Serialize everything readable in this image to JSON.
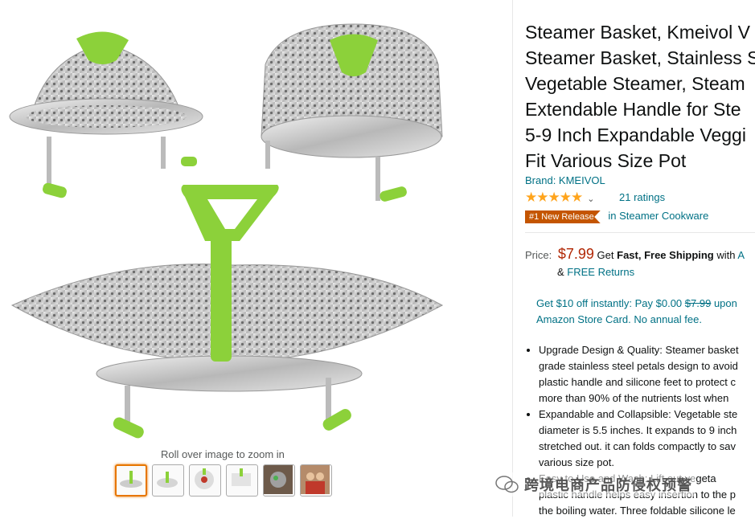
{
  "gallery": {
    "zoom_caption": "Roll over image to zoom in",
    "thumbnails": [
      "thumb-1",
      "thumb-2",
      "thumb-3",
      "thumb-4",
      "thumb-5",
      "thumb-6"
    ],
    "selected_index": 0
  },
  "product": {
    "title_lines": [
      "Steamer Basket, Kmeivol V",
      "Steamer Basket, Stainless S",
      "Vegetable Steamer, Steam",
      "Extendable Handle for Ste",
      "5-9 Inch Expandable Veggi",
      "Fit Various Size Pot"
    ],
    "brand": "Brand: KMEIVOL",
    "stars": "★★★★★",
    "rating_value": 5,
    "ratings_count": "21 ratings",
    "badge": "#1 New Release",
    "badge_category": "in Steamer Cookware"
  },
  "price": {
    "label": "Price:",
    "value": "$7.99",
    "get": "Get",
    "shipping_bold": "Fast, Free Shipping",
    "with": "with",
    "with_link": "A",
    "amp": "&",
    "returns": "FREE Returns"
  },
  "promo": {
    "line1_a": "Get $10 off instantly: Pay $0.00",
    "line1_strike": "$7.99",
    "line1_b": "upon",
    "line2": "Amazon Store Card. No annual fee."
  },
  "bullets": [
    [
      "Upgrade Design & Quality: Steamer basket",
      "grade stainless steel petals design to avoid",
      "plastic handle and silicone feet to protect c",
      "more than 90% of the nutrients lost when"
    ],
    [
      "Expandable and Collapsible: Vegetable ste",
      "diameter is 5.5 inches. It expands to 9 inch",
      "stretched out. it can folds compactly to sav",
      "various size pot."
    ],
    [
      "Easy to Use and Wash: Lift out vegeta",
      "plastic handle helps easy insertion to the p",
      "the boiling water. Three foldable silicone le"
    ]
  ],
  "watermark": {
    "text": "跨境电商产品防侵权预警"
  },
  "colors": {
    "accent_green": "#8cd13a",
    "link": "#007185",
    "price": "#b12704",
    "star": "#ffa41c",
    "badge": "#c45500"
  }
}
